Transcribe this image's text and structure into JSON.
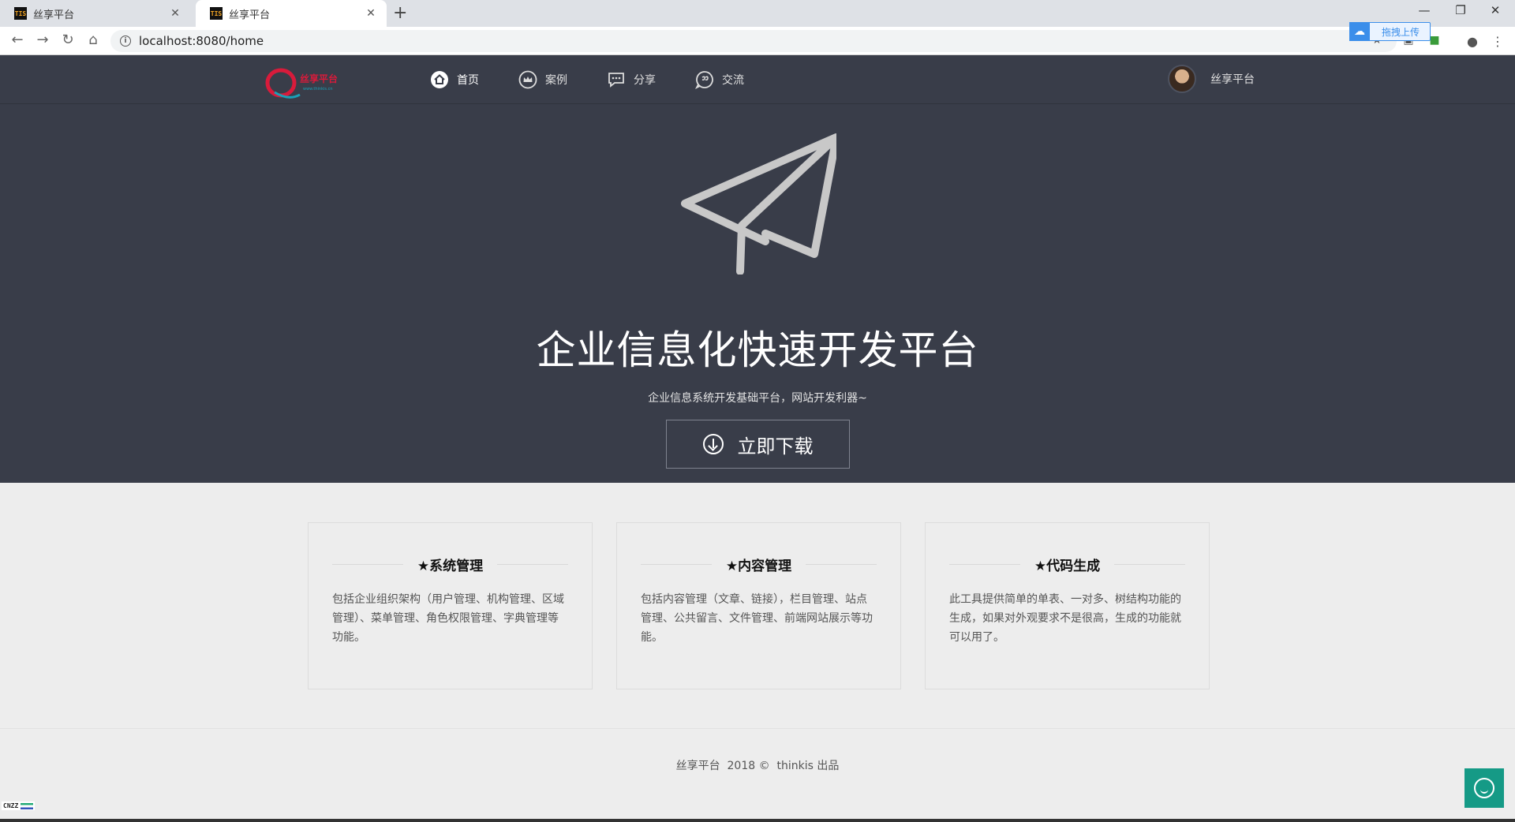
{
  "browser": {
    "tabs": [
      {
        "title": "丝享平台",
        "favicon": "TIS"
      },
      {
        "title": "丝享平台",
        "favicon": "TIS"
      }
    ],
    "url": "localhost:8080/home",
    "extension_popup": "拖拽上传"
  },
  "header": {
    "logo_text": "丝享平台",
    "logo_subtext": "www.thinkis.cn",
    "nav": [
      {
        "label": "首页",
        "icon": "home-icon"
      },
      {
        "label": "案例",
        "icon": "crown-icon"
      },
      {
        "label": "分享",
        "icon": "chat-dots-icon"
      },
      {
        "label": "交流",
        "icon": "message-icon"
      }
    ],
    "user_name": "丝享平台"
  },
  "hero": {
    "title": "企业信息化快速开发平台",
    "subtitle": "企业信息系统开发基础平台，网站开发利器~",
    "download_label": "立即下载"
  },
  "features": [
    {
      "title": "★系统管理",
      "text": "包括企业组织架构（用户管理、机构管理、区域管理）、菜单管理、角色权限管理、字典管理等功能。"
    },
    {
      "title": "★内容管理",
      "text": "包括内容管理（文章、链接），栏目管理、站点管理、公共留言、文件管理、前端网站展示等功能。"
    },
    {
      "title": "★代码生成",
      "text": "此工具提供简单的单表、一对多、树结构功能的生成，如果对外观要求不是很高，生成的功能就可以用了。"
    }
  ],
  "footer": "丝享平台  2018 ©  thinkis 出品",
  "cnzz_label": "CNZZ",
  "colors": {
    "header_bg": "#393d49",
    "accent": "#159a86",
    "logo_red": "#d81b3b"
  }
}
